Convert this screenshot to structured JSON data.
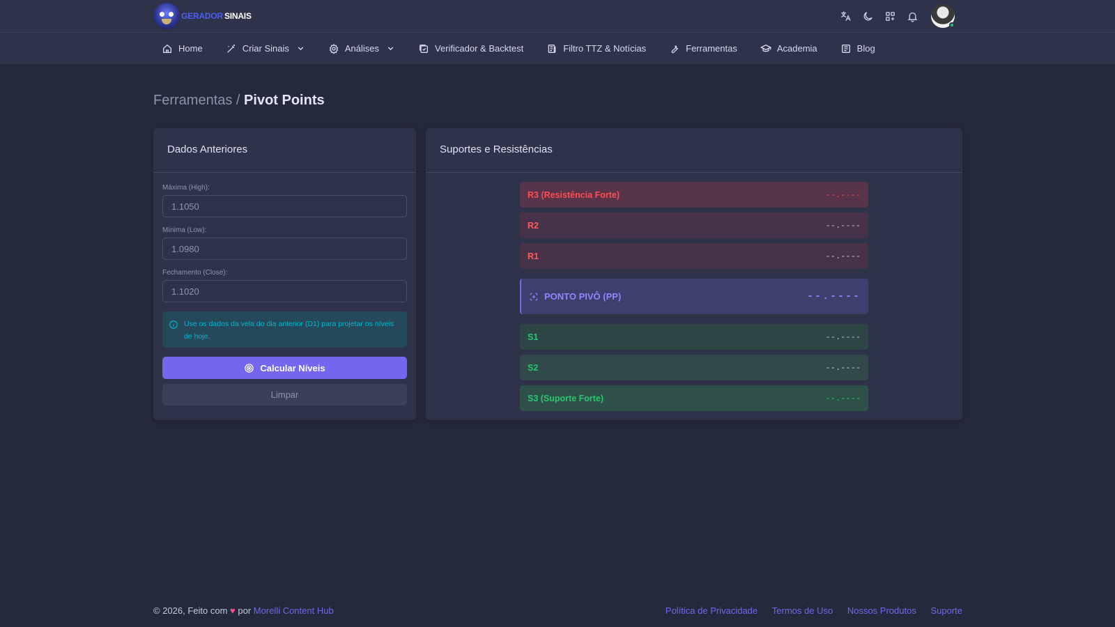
{
  "brand": {
    "part1": "GERADOR",
    "part2": "SINAIS"
  },
  "nav": [
    {
      "label": "Home",
      "icon": "home-icon",
      "dropdown": false
    },
    {
      "label": "Criar Sinais",
      "icon": "magic-wand-icon",
      "dropdown": true
    },
    {
      "label": "Análises",
      "icon": "gear-icon",
      "dropdown": true
    },
    {
      "label": "Verificador & Backtest",
      "icon": "checklist-icon",
      "dropdown": false
    },
    {
      "label": "Filtro TTZ & Notícias",
      "icon": "news-icon",
      "dropdown": false
    },
    {
      "label": "Ferramentas",
      "icon": "tools-icon",
      "dropdown": false
    },
    {
      "label": "Academia",
      "icon": "graduation-cap-icon",
      "dropdown": false
    },
    {
      "label": "Blog",
      "icon": "article-icon",
      "dropdown": false
    }
  ],
  "breadcrumb": {
    "parent": "Ferramentas /",
    "current": "Pivot Points"
  },
  "left_card": {
    "title": "Dados Anteriores",
    "fields": [
      {
        "label": "Máxima (High):",
        "placeholder": "1.1050"
      },
      {
        "label": "Mínima (Low):",
        "placeholder": "1.0980"
      },
      {
        "label": "Fechamento (Close):",
        "placeholder": "1.1020"
      }
    ],
    "alert": "Use os dados da vela do dia anterior (D1) para projetar os níveis de hoje.",
    "calc_label": "Calcular Níveis",
    "clear_label": "Limpar"
  },
  "right_card": {
    "title": "Suportes e Resistências",
    "levels": {
      "r3": {
        "label": "R3 (Resistência Forte)",
        "value": "--.----"
      },
      "r2": {
        "label": "R2",
        "value": "--.----"
      },
      "r1": {
        "label": "R1",
        "value": "--.----"
      },
      "pp": {
        "label": "PONTO PIVÔ (PP)",
        "value": "--.----"
      },
      "s1": {
        "label": "S1",
        "value": "--.----"
      },
      "s2": {
        "label": "S2",
        "value": "--.----"
      },
      "s3": {
        "label": "S3 (Suporte Forte)",
        "value": "--.----"
      }
    }
  },
  "footer": {
    "copyright": "© 2026, Feito com",
    "heart": "♥",
    "by": "por",
    "author": "Morelli Content Hub",
    "links": [
      "Política de Privacidade",
      "Termos de Uso",
      "Nossos Produtos",
      "Suporte"
    ]
  },
  "colors": {
    "accent": "#7367f0",
    "danger": "#ff4c51",
    "success": "#28c76f",
    "info": "#00bad1"
  }
}
